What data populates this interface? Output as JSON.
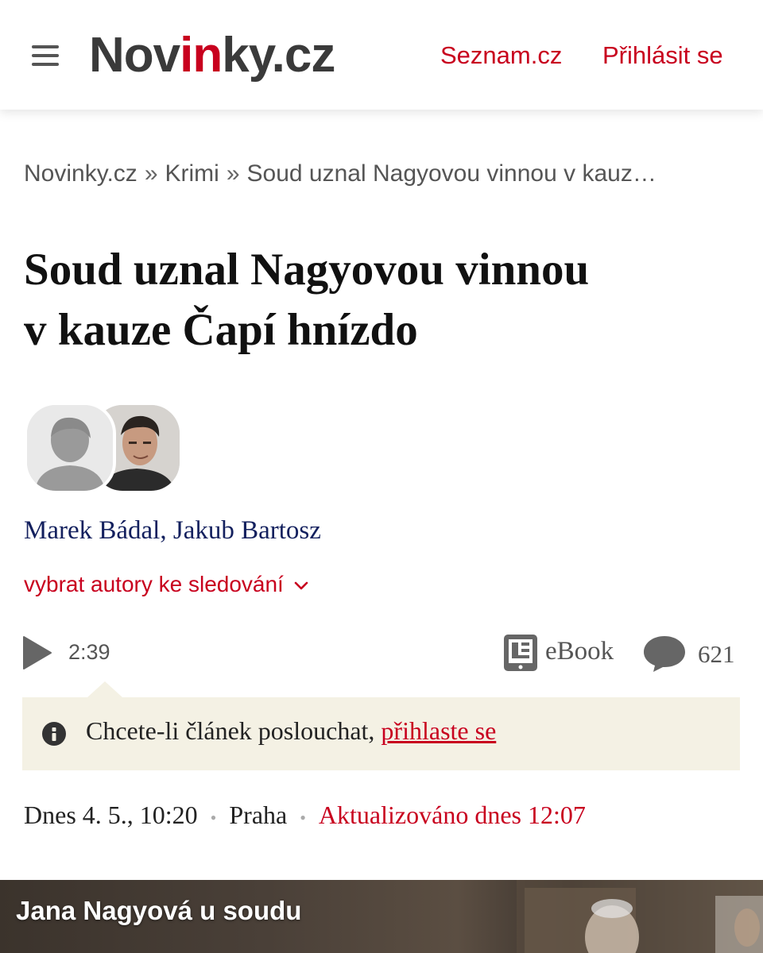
{
  "header": {
    "logo_prefix": "Nov",
    "logo_accent": "in",
    "logo_suffix": "ky.cz",
    "seznam_link": "Seznam.cz",
    "login_link": "Přihlásit se"
  },
  "breadcrumb": {
    "items": [
      "Novinky.cz",
      "Krimi",
      "Soud uznal Nagyovou vinnou v kauz…"
    ],
    "separator": "»"
  },
  "article": {
    "title_line1": "Soud uznal Nagyovou vinnou",
    "title_line2": "v kauze Čapí hnízdo",
    "author1": "Marek Bádal",
    "author_separator": ", ",
    "author2": "Jakub Bartosz",
    "follow_label": "vybrat autory ke sledování",
    "audio_duration": "2:39",
    "ebook_label": "eBook",
    "comments_count": "621",
    "notice_text": "Chcete-li článek poslouchat, ",
    "notice_link": "přihlaste se",
    "date": "Dnes 4. 5., 10:20",
    "location": "Praha",
    "updated": "Aktualizováno dnes 12:07",
    "meta_dot": "•",
    "photo_caption": "Jana Nagyová u soudu"
  },
  "icons": {
    "menu": "hamburger-icon",
    "avatar_placeholder": "user-silhouette-icon",
    "follow_chevron": "chevron-down-icon",
    "play": "play-icon",
    "ebook": "ebook-reader-icon",
    "comments": "speech-bubble-icon",
    "notice": "info-icon"
  },
  "colors": {
    "accent_red": "#c8001e",
    "author_blue": "#13205e",
    "notice_bg": "#f4f1e4"
  }
}
